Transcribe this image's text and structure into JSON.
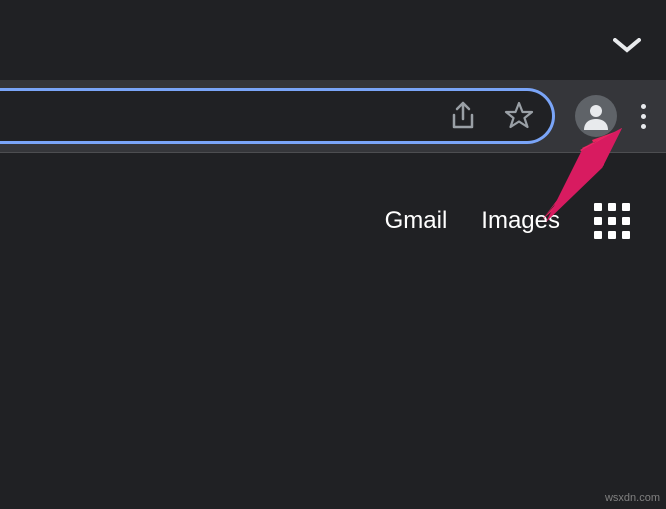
{
  "toolbar": {
    "share_icon": "share-icon",
    "bookmark_icon": "star-icon",
    "profile_icon": "avatar-icon",
    "menu_icon": "menu-kebab-icon"
  },
  "tab_strip": {
    "collapse_icon": "chevron-down-icon"
  },
  "content": {
    "links": {
      "gmail": "Gmail",
      "images": "Images"
    },
    "apps_icon": "apps-grid-icon"
  },
  "watermark": "wsxdn.com"
}
